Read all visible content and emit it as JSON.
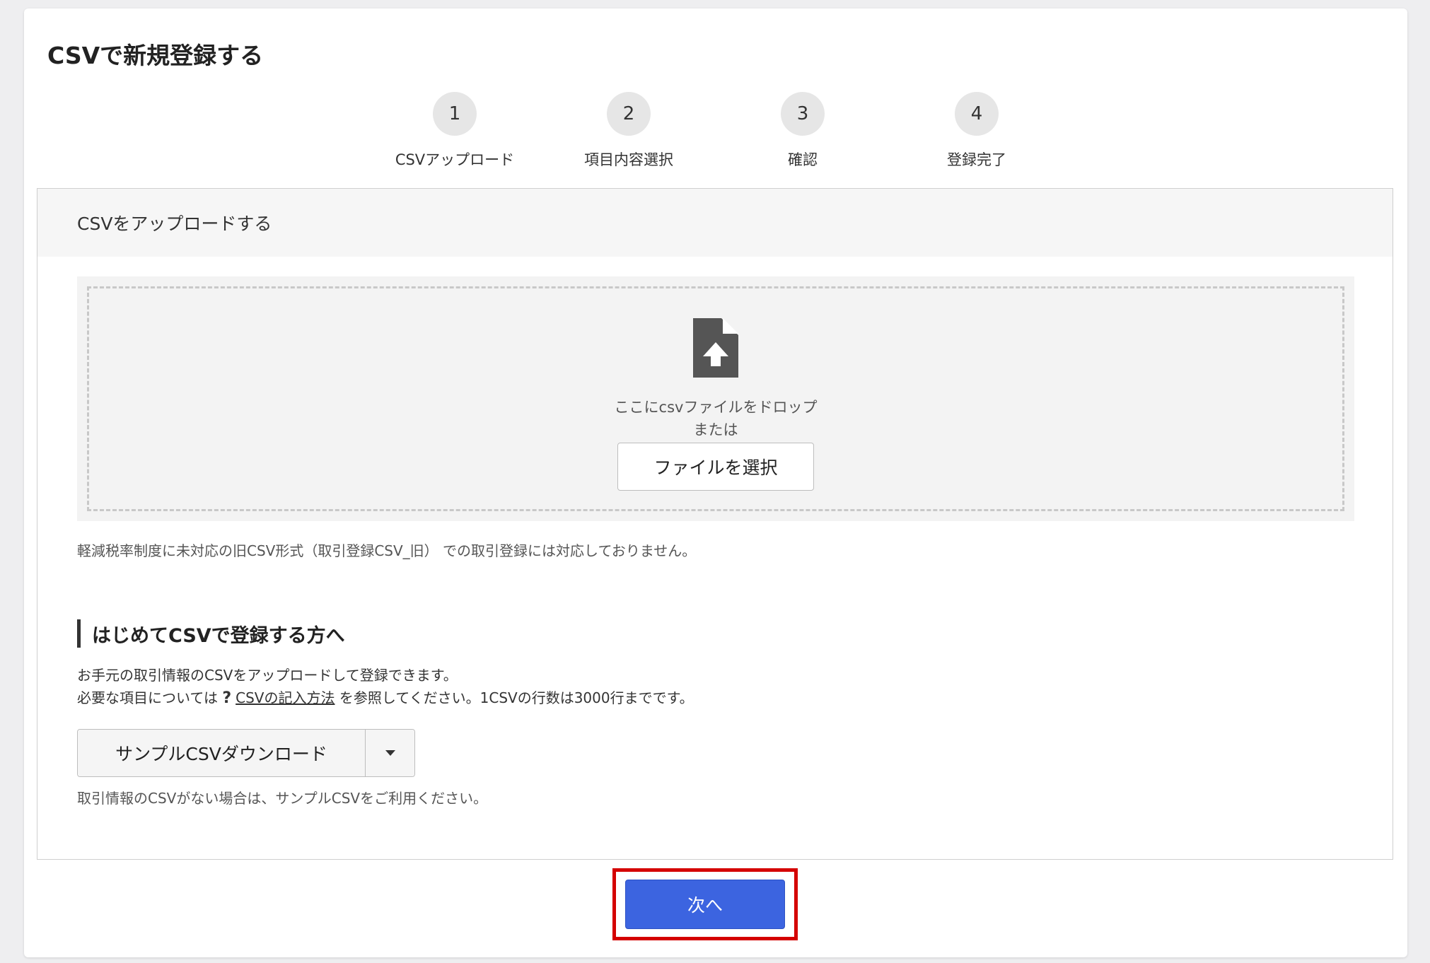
{
  "page": {
    "title": "CSVで新規登録する"
  },
  "stepper": {
    "steps": [
      {
        "number": "1",
        "label": "CSVアップロード"
      },
      {
        "number": "2",
        "label": "項目内容選択"
      },
      {
        "number": "3",
        "label": "確認"
      },
      {
        "number": "4",
        "label": "登録完了"
      }
    ]
  },
  "upload": {
    "header": "CSVをアップロードする",
    "drop_text": "ここにcsvファイルをドロップ",
    "or_text": "または",
    "select_button": "ファイルを選択",
    "icon": "file-upload-icon",
    "note": "軽減税率制度に未対応の旧CSV形式（取引登録CSV_旧） での取引登録には対応しておりません。"
  },
  "guide": {
    "heading": "はじめてCSVで登録する方へ",
    "line1": "お手元の取引情報のCSVをアップロードして登録できます。",
    "line2_prefix": "必要な項目については",
    "help_icon": "?",
    "link_text": "CSVの記入方法",
    "line2_suffix": "を参照してください。1CSVの行数は3000行までです。",
    "download_button": "サンプルCSVダウンロード",
    "download_note": "取引情報のCSVがない場合は、サンプルCSVをご利用ください。"
  },
  "footer": {
    "next_button": "次へ"
  },
  "colors": {
    "primary": "#3c64e0",
    "highlight": "#d40000",
    "background": "#eeeef0"
  }
}
